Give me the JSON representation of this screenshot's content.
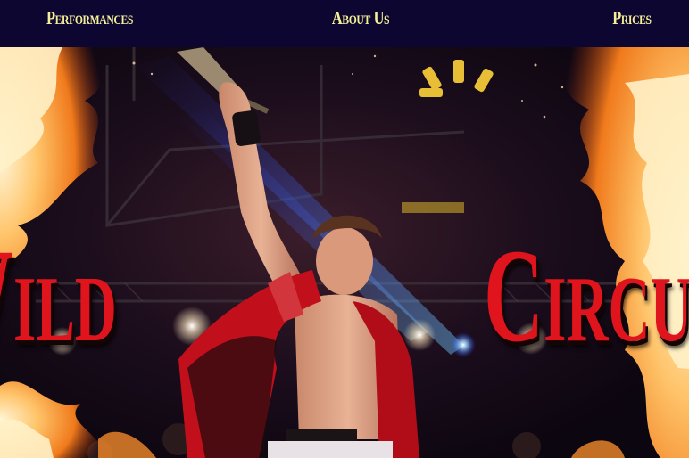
{
  "nav": {
    "items": [
      {
        "label": "Performances"
      },
      {
        "label": "About Us"
      },
      {
        "label": "Prices"
      }
    ]
  },
  "hero": {
    "title_left": "Wild",
    "title_right": "Circus"
  },
  "colors": {
    "nav_background": "#0c0631",
    "nav_text": "#f6ef9a",
    "title_red": "#e0141d",
    "fire_orange": "#f07a1c"
  }
}
